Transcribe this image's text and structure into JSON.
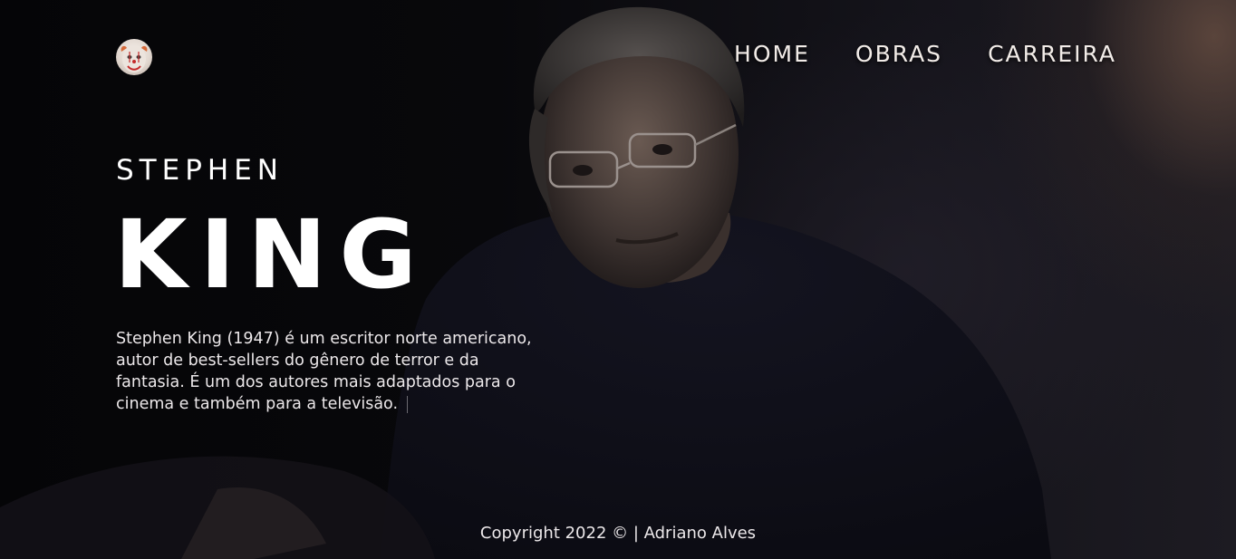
{
  "nav": {
    "items": [
      "HOME",
      "OBRAS",
      "CARREIRA"
    ]
  },
  "hero": {
    "first_name": "STEPHEN",
    "last_name": "KING",
    "bio": "Stephen King (1947) é um escritor norte americano, autor de best-sellers do gênero de terror e da fantasia. É um dos autores mais adaptados para o cinema e também para a televisão."
  },
  "footer": {
    "text": "Copyright 2022 © | Adriano Alves"
  },
  "icons": {
    "logo": "pennywise-clown-icon"
  },
  "colors": {
    "background": "#07070a",
    "text": "#ffffff",
    "nav_text": "#f2ece8",
    "warm_glow": "#6e5244"
  }
}
